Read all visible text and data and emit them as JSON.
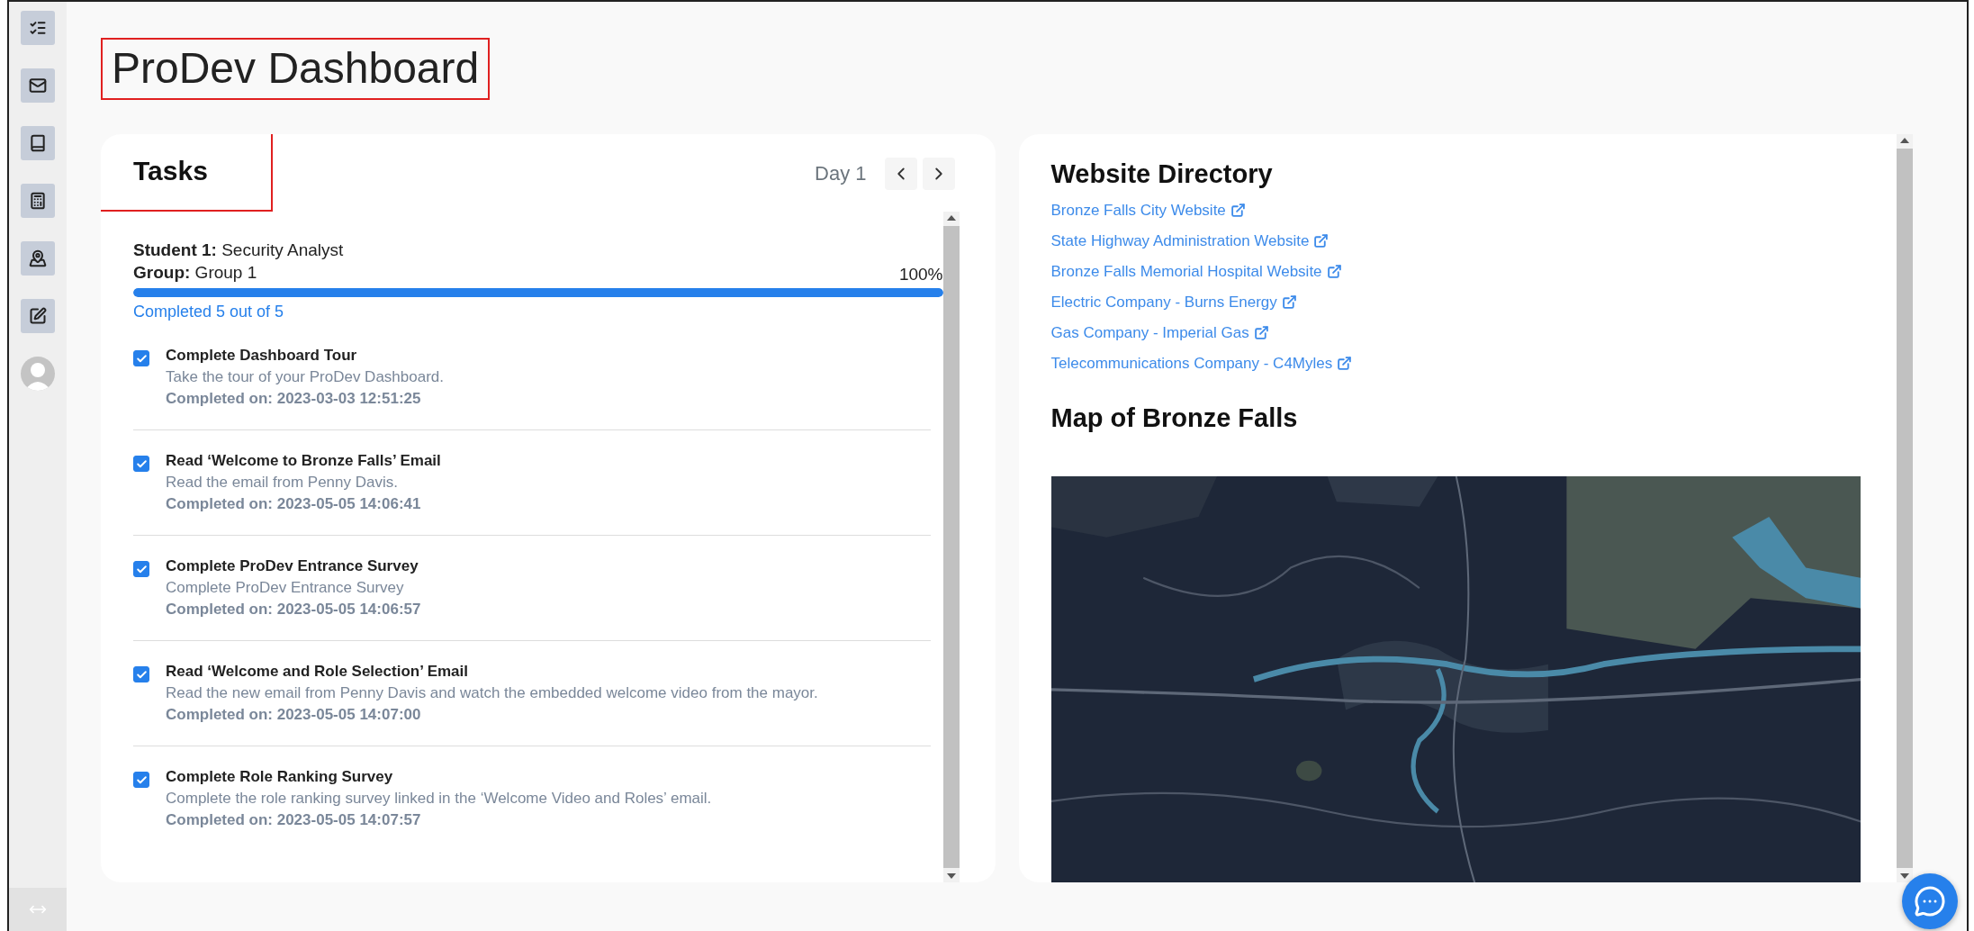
{
  "title": "ProDev Dashboard",
  "tasks": {
    "heading": "Tasks",
    "day": "Day 1",
    "student_label": "Student 1:",
    "student_value": "Security Analyst",
    "group_label": "Group:",
    "group_value": "Group 1",
    "percent": "100%",
    "level": 1,
    "summary": "Completed 5 out of 5",
    "items": [
      {
        "checked": true,
        "title": "Complete Dashboard Tour",
        "description": "Take the tour of your ProDev Dashboard.",
        "completed": "Completed on: 2023-03-03 12:51:25"
      },
      {
        "checked": true,
        "title": "Read ‘Welcome to Bronze Falls’ Email",
        "description": "Read the email from Penny Davis.",
        "completed": "Completed on: 2023-05-05 14:06:41"
      },
      {
        "checked": true,
        "title": "Complete ProDev Entrance Survey",
        "description": "Complete ProDev Entrance Survey",
        "completed": "Completed on: 2023-05-05 14:06:57"
      },
      {
        "checked": true,
        "title": "Read ‘Welcome and Role Selection’ Email",
        "description": "Read the new email from Penny Davis and watch the embedded welcome video from the mayor.",
        "completed": "Completed on: 2023-05-05 14:07:00"
      },
      {
        "checked": true,
        "title": "Complete Role Ranking Survey",
        "description": "Complete the role ranking survey linked in the ‘Welcome Video and Roles’ email.",
        "completed": "Completed on: 2023-05-05 14:07:57"
      }
    ]
  },
  "directory": {
    "heading": "Website Directory",
    "links": [
      "Bronze Falls City Website",
      "State Highway Administration Website",
      "Bronze Falls Memorial Hospital Website",
      "Electric Company - Burns Energy",
      "Gas Company - Imperial Gas",
      "Telecommunications Company - C4Myles"
    ]
  },
  "map": {
    "heading": "Map of Bronze Falls",
    "kind": "picture"
  }
}
